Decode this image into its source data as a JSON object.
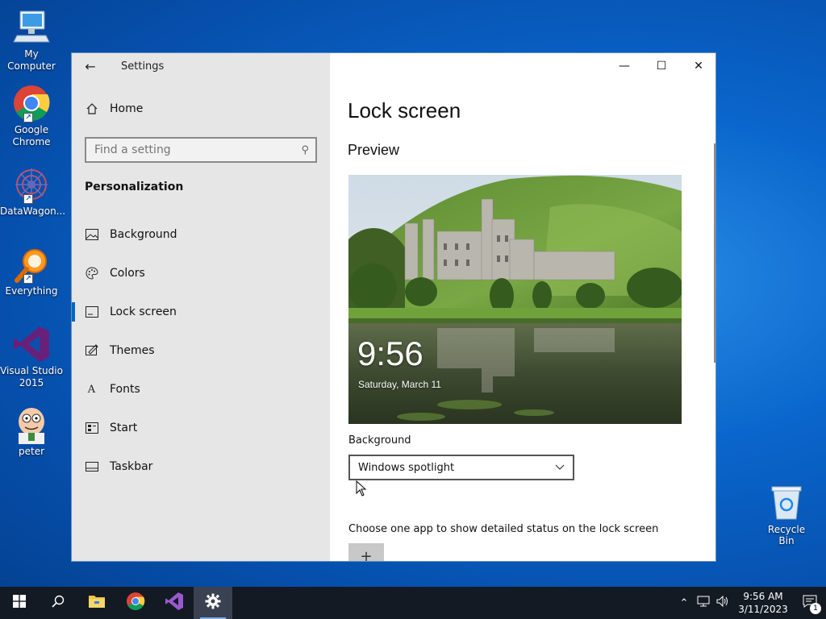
{
  "desktop": {
    "icons": [
      {
        "label": "My Computer"
      },
      {
        "label": "Google Chrome"
      },
      {
        "label": "DataWagon..."
      },
      {
        "label": "Everything"
      },
      {
        "label": "Visual Studio 2015"
      },
      {
        "label": "peter"
      }
    ],
    "recycle_bin": "Recycle Bin"
  },
  "window": {
    "title": "Settings",
    "sidebar": {
      "home": "Home",
      "search_placeholder": "Find a setting",
      "section": "Personalization",
      "items": [
        {
          "label": "Background",
          "icon": "image-icon"
        },
        {
          "label": "Colors",
          "icon": "palette-icon"
        },
        {
          "label": "Lock screen",
          "icon": "lock-screen-icon",
          "active": true
        },
        {
          "label": "Themes",
          "icon": "themes-icon"
        },
        {
          "label": "Fonts",
          "icon": "fonts-icon"
        },
        {
          "label": "Start",
          "icon": "start-icon"
        },
        {
          "label": "Taskbar",
          "icon": "taskbar-icon"
        }
      ]
    },
    "content": {
      "page_title": "Lock screen",
      "preview_label": "Preview",
      "preview_time": "9:56",
      "preview_date": "Saturday, March 11",
      "background_label": "Background",
      "background_value": "Windows spotlight",
      "status_app_label": "Choose one app to show detailed status on the lock screen",
      "add_button_glyph": "+"
    }
  },
  "taskbar": {
    "time": "9:56 AM",
    "date": "3/11/2023",
    "notification_count": "1"
  },
  "colors": {
    "accent": "#0067c0",
    "taskbar": "#141a24",
    "sidebar": "#e6e6e6"
  }
}
